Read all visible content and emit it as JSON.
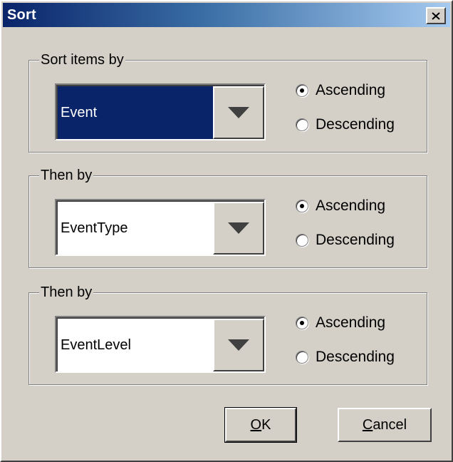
{
  "window": {
    "title": "Sort",
    "close_icon": "close-icon"
  },
  "groups": [
    {
      "legend": "Sort items by",
      "selected_value": "Event",
      "highlighted": true,
      "ascending_label": "Ascending",
      "descending_label": "Descending",
      "order": "Ascending"
    },
    {
      "legend": "Then by",
      "selected_value": "EventType",
      "highlighted": false,
      "ascending_label": "Ascending",
      "descending_label": "Descending",
      "order": "Ascending"
    },
    {
      "legend": "Then by",
      "selected_value": "EventLevel",
      "highlighted": false,
      "ascending_label": "Ascending",
      "descending_label": "Descending",
      "order": "Ascending"
    }
  ],
  "buttons": {
    "ok": {
      "mnemonic": "O",
      "rest": "K"
    },
    "cancel": {
      "mnemonic": "C",
      "rest": "ancel"
    }
  },
  "colors": {
    "face": "#d4d0c8",
    "selection": "#0a246a",
    "title_gradient_start": "#0a246a",
    "title_gradient_end": "#a6caf0"
  }
}
